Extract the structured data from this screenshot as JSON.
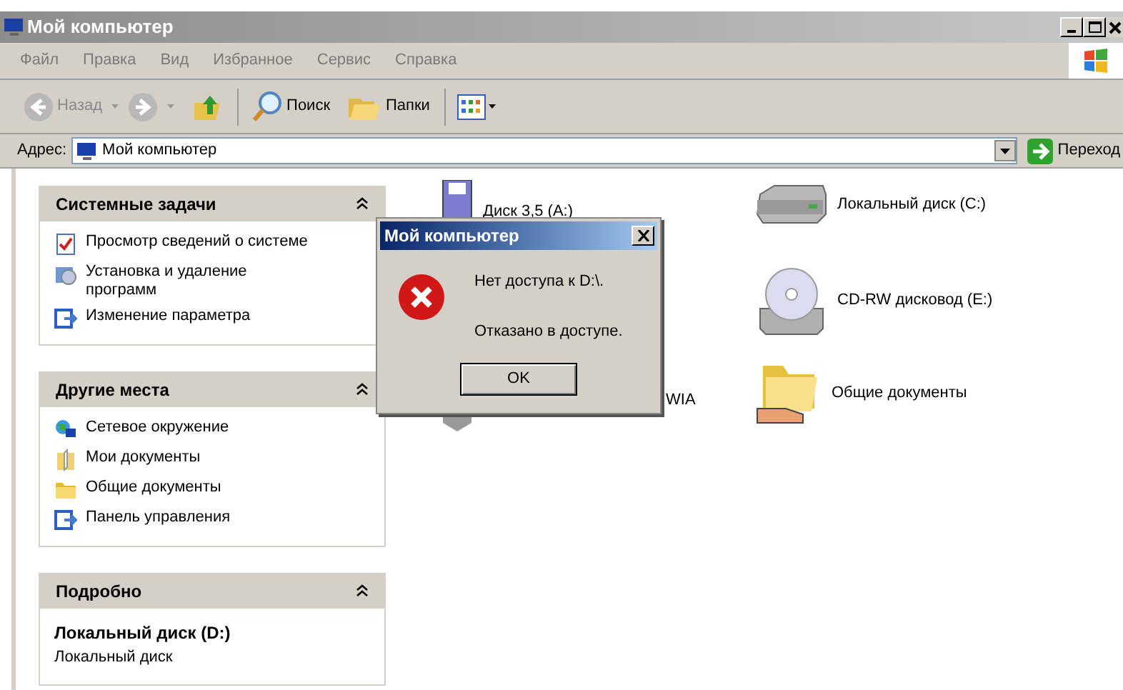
{
  "window": {
    "title": "Мой компьютер"
  },
  "menu": [
    "Файл",
    "Правка",
    "Вид",
    "Избранное",
    "Сервис",
    "Справка"
  ],
  "toolbar": {
    "back": "Назад",
    "search": "Поиск",
    "folders": "Папки"
  },
  "address": {
    "label": "Адрес:",
    "value": "Мой компьютер",
    "go": "Переход"
  },
  "panels": [
    {
      "title": "Системные задачи",
      "items": [
        {
          "kind": "sysinfo",
          "label": "Просмотр сведений о системе"
        },
        {
          "kind": "addremove",
          "label": "Установка и удаление программ"
        },
        {
          "kind": "control",
          "label": "Изменение параметра"
        }
      ]
    },
    {
      "title": "Другие места",
      "items": [
        {
          "kind": "network",
          "label": "Сетевое окружение"
        },
        {
          "kind": "mydocs",
          "label": "Мои документы"
        },
        {
          "kind": "folder",
          "label": "Общие документы"
        },
        {
          "kind": "control",
          "label": "Панель управления"
        }
      ]
    },
    {
      "title": "Подробно",
      "details": {
        "name": "Локальный диск (D:)",
        "type": "Локальный диск"
      }
    }
  ],
  "items": [
    {
      "kind": "floppy",
      "label": "Диск 3,5 (A:)"
    },
    {
      "kind": "scanner",
      "label": "WIA"
    },
    {
      "kind": "harddisk",
      "label": "Локальный диск (C:)"
    },
    {
      "kind": "cdrom",
      "label": "CD-RW дисковод (E:)"
    },
    {
      "kind": "shared",
      "label": "Общие документы"
    }
  ],
  "dialog": {
    "title": "Мой компьютер",
    "lines": [
      "Нет доступа к D:\\.",
      "Отказано в доступе."
    ],
    "button": "OK"
  }
}
